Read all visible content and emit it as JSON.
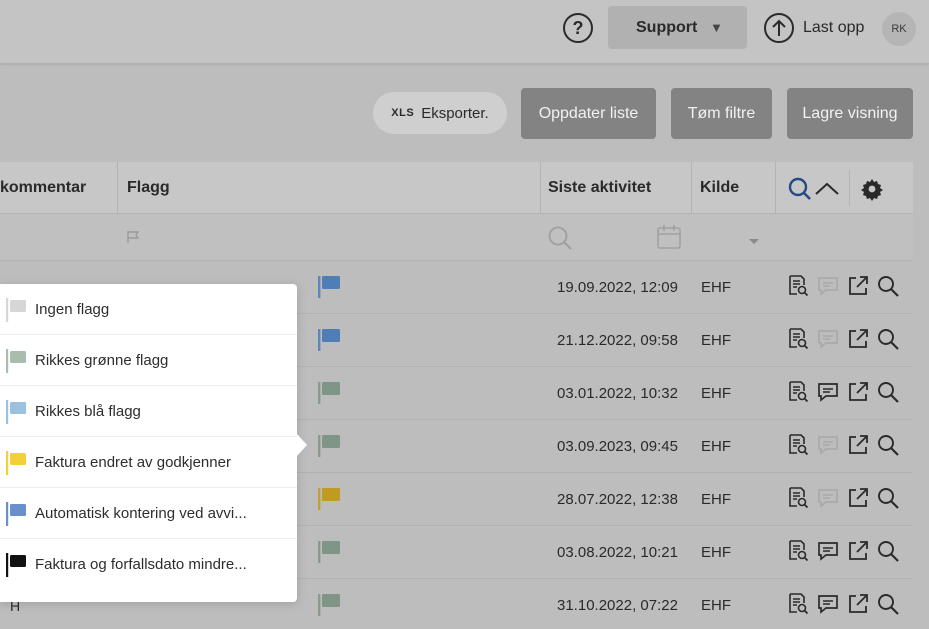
{
  "topbar": {
    "help_label": "?",
    "support_label": "Support",
    "support_caret": "▼",
    "upload_label": "Last opp",
    "avatar_initials": "RK"
  },
  "toolbar": {
    "export_prefix": "XLS",
    "export_label": "Eksporter.",
    "refresh_label": "Oppdater liste",
    "clear_filters_label": "Tøm filtre",
    "save_view_label": "Lagre visning"
  },
  "table": {
    "columns": [
      "kommentar",
      "Flagg",
      "Siste aktivitet",
      "Kilde"
    ],
    "rows": [
      {
        "date": "19.09.2022, 12:09",
        "source": "EHF",
        "flag_color": "#4f7db5",
        "comment_active": false
      },
      {
        "date": "21.12.2022, 09:58",
        "source": "EHF",
        "flag_color": "#4f7db5",
        "comment_active": false
      },
      {
        "date": "03.01.2022, 10:32",
        "source": "EHF",
        "flag_color": "#7f9686",
        "comment_active": true
      },
      {
        "date": "03.09.2023, 09:45",
        "source": "EHF",
        "flag_color": "#7f9686",
        "comment_active": false
      },
      {
        "date": "28.07.2022, 12:38",
        "source": "EHF",
        "flag_color": "#bf9b22",
        "comment_active": false
      },
      {
        "date": "03.08.2022, 10:21",
        "source": "EHF",
        "flag_color": "#7f9686",
        "comment_active": true
      },
      {
        "date": "31.10.2022, 07:22",
        "source": "EHF",
        "flag_color": "#7f9686",
        "comment_active": true
      }
    ],
    "last_row_left_text": "H"
  },
  "flag_dropdown": {
    "items": [
      {
        "label": "Ingen flagg",
        "color": "#d6d6d6"
      },
      {
        "label": "Rikkes grønne flagg",
        "color": "#a9bdaf"
      },
      {
        "label": "Rikkes blå flagg",
        "color": "#9cc0e0"
      },
      {
        "label": "Faktura endret av godkjenner",
        "color": "#f3cf3a"
      },
      {
        "label": "Automatisk kontering ved avvi...",
        "color": "#6a8fcd"
      },
      {
        "label": "Faktura og forfallsdato mindre...",
        "color": "#111111"
      }
    ]
  }
}
